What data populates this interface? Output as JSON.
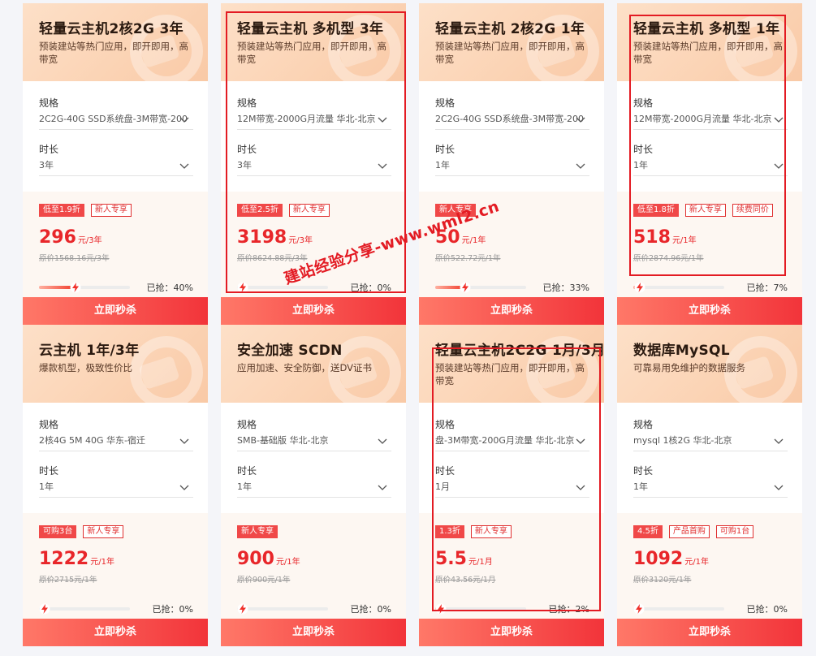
{
  "labels": {
    "spec": "规格",
    "duration": "时长",
    "sold_prefix": "已抢：",
    "buy": "立即秒杀"
  },
  "accent": "#e8262a",
  "highlight_color": "#e31b23",
  "cards": [
    {
      "title": "轻量云主机2核2G 3年",
      "subtitle": "预装建站等热门应用，即开即用，高带宽",
      "spec": "2C2G-40G SSD系统盘-3M带宽-200",
      "duration": "3年",
      "tags": [
        {
          "text": "低至1.9折",
          "filled": true
        },
        {
          "text": "新人专享",
          "filled": false
        }
      ],
      "price": "296",
      "unit": "元/3年",
      "original": "原价1568.16元/3年",
      "sold": "40%",
      "progress": 0.4
    },
    {
      "title": "轻量云主机 多机型 3年",
      "subtitle": "预装建站等热门应用，即开即用，高带宽",
      "spec": "12M带宽-2000G月流量 华北-北京",
      "duration": "3年",
      "tags": [
        {
          "text": "低至2.5折",
          "filled": true
        },
        {
          "text": "新人专享",
          "filled": false
        }
      ],
      "price": "3198",
      "unit": "元/3年",
      "original": "原价8624.88元/3年",
      "sold": "0%",
      "progress": 0.0
    },
    {
      "title": "轻量云主机 2核2G 1年",
      "subtitle": "预装建站等热门应用，即开即用，高带宽",
      "spec": "2C2G-40G SSD系统盘-3M带宽-200",
      "duration": "1年",
      "tags": [
        {
          "text": "新人专享",
          "filled": true
        }
      ],
      "price": "50",
      "unit": "元/1年",
      "original": "原价522.72元/1年",
      "sold": "33%",
      "progress": 0.33
    },
    {
      "title": "轻量云主机 多机型 1年",
      "subtitle": "预装建站等热门应用，即开即用，高带宽",
      "spec": "12M带宽-2000G月流量 华北-北京",
      "duration": "1年",
      "tags": [
        {
          "text": "低至1.8折",
          "filled": true
        },
        {
          "text": "新人专享",
          "filled": false
        },
        {
          "text": "续费同价",
          "filled": false
        }
      ],
      "price": "518",
      "unit": "元/1年",
      "original": "原价2874.96元/1年",
      "sold": "7%",
      "progress": 0.07
    },
    {
      "title": "云主机 1年/3年",
      "subtitle": "爆款机型，极致性价比",
      "spec": "2核4G 5M 40G 华东-宿迁",
      "duration": "1年",
      "tags": [
        {
          "text": "可购3台",
          "filled": true
        },
        {
          "text": "新人专享",
          "filled": false
        }
      ],
      "price": "1222",
      "unit": "元/1年",
      "original": "原价2715元/1年",
      "sold": "0%",
      "progress": 0.0
    },
    {
      "title": "安全加速 SCDN",
      "subtitle": "应用加速、安全防御，送DV证书",
      "spec": "SMB-基础版 华北-北京",
      "duration": "1年",
      "tags": [
        {
          "text": "新人专享",
          "filled": true
        }
      ],
      "price": "900",
      "unit": "元/1年",
      "original": "原价900元/1年",
      "sold": "0%",
      "progress": 0.0
    },
    {
      "title": "轻量云主机2C2G 1月/3月",
      "subtitle": "预装建站等热门应用，即开即用，高带宽",
      "spec": "盘-3M带宽-200G月流量 华北-北京",
      "duration": "1月",
      "tags": [
        {
          "text": "1.3折",
          "filled": true
        },
        {
          "text": "新人专享",
          "filled": false
        }
      ],
      "price": "5.5",
      "unit": "元/1月",
      "original": "原价43.56元/1月",
      "sold": "2%",
      "progress": 0.02
    },
    {
      "title": "数据库MySQL",
      "subtitle": "可靠易用免维护的数据服务",
      "spec": "mysql 1核2G 华北-北京",
      "duration": "1年",
      "tags": [
        {
          "text": "4.5折",
          "filled": true
        },
        {
          "text": "产品首购",
          "filled": false
        },
        {
          "text": "可购1台",
          "filled": false
        }
      ],
      "price": "1092",
      "unit": "元/1年",
      "original": "原价3120元/1年",
      "sold": "0%",
      "progress": 0.0
    }
  ],
  "watermark": "建站经验分享-www.wml2.cn"
}
